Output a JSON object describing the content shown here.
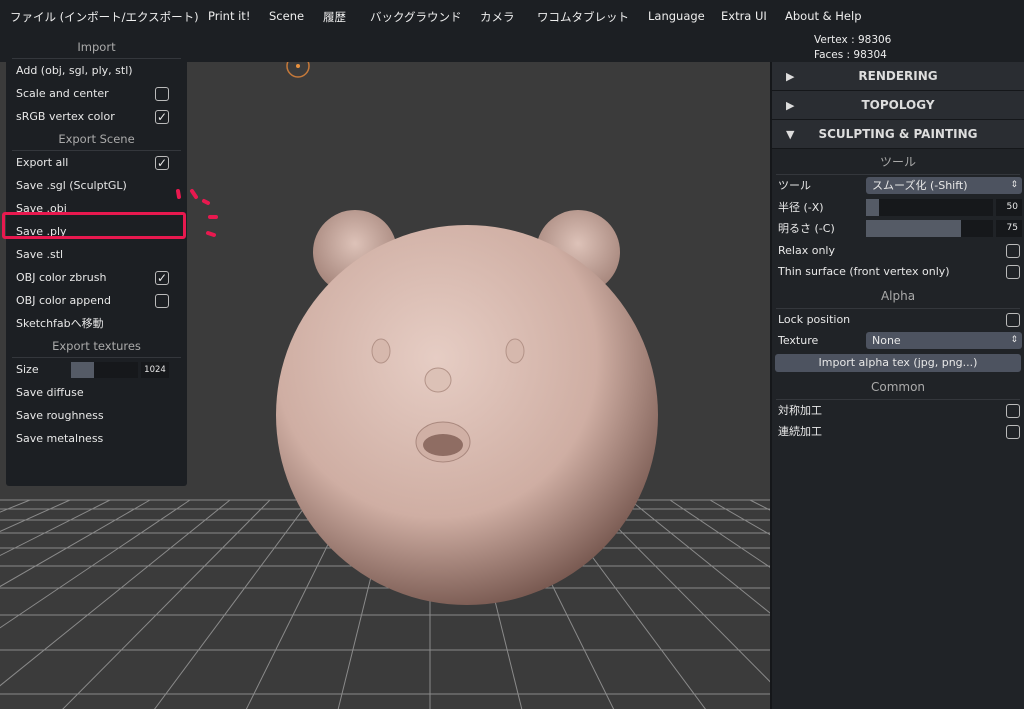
{
  "menubar": {
    "items": [
      "ファイル (インポート/エクスポート)",
      "Print it!",
      "Scene",
      "履歴",
      "バックグラウンド",
      "カメラ",
      "ワコムタブレット",
      "Language",
      "Extra UI",
      "About & Help"
    ]
  },
  "stats": {
    "vertex": "Vertex : 98306",
    "faces": "Faces : 98304"
  },
  "file_menu": {
    "import_title": "Import",
    "add": "Add (obj, sgl, ply, stl)",
    "scale_center": "Scale and center",
    "srgb": "sRGB vertex color",
    "export_scene_title": "Export Scene",
    "export_all": "Export all",
    "save_sgl": "Save .sgl (SculptGL)",
    "save_obj": "Save .obj",
    "save_ply": "Save .ply",
    "save_stl": "Save .stl",
    "obj_color_zbrush": "OBJ color zbrush",
    "obj_color_append": "OBJ color append",
    "sketchfab": "Sketchfabへ移動",
    "export_textures_title": "Export textures",
    "size_label": "Size",
    "size_value": "1024",
    "size_fraction": 0.35,
    "save_diffuse": "Save diffuse",
    "save_roughness": "Save roughness",
    "save_metalness": "Save metalness",
    "checks": {
      "scale_center": false,
      "srgb": true,
      "export_all": true,
      "obj_color_zbrush": true,
      "obj_color_append": false
    }
  },
  "right_panel": {
    "rendering": "RENDERING",
    "topology": "TOPOLOGY",
    "sculpting": "SCULPTING & PAINTING",
    "tool_section": "ツール",
    "tool_label": "ツール",
    "tool_value": "スムーズ化 (-Shift)",
    "radius_label": "半径 (-X)",
    "radius_value": "50",
    "radius_fraction": 0.1,
    "intensity_label": "明るさ (-C)",
    "intensity_value": "75",
    "intensity_fraction": 0.75,
    "relax_only": "Relax only",
    "thin_surface": "Thin surface (front vertex only)",
    "alpha_section": "Alpha",
    "lock_position": "Lock position",
    "texture_label": "Texture",
    "texture_value": "None",
    "import_alpha": "Import alpha tex (jpg, png...)",
    "common_section": "Common",
    "symmetry": "対称加工",
    "continuous": "連続加工"
  },
  "colors": {
    "highlight": "#e8194f",
    "model": "#d9bcb2"
  }
}
